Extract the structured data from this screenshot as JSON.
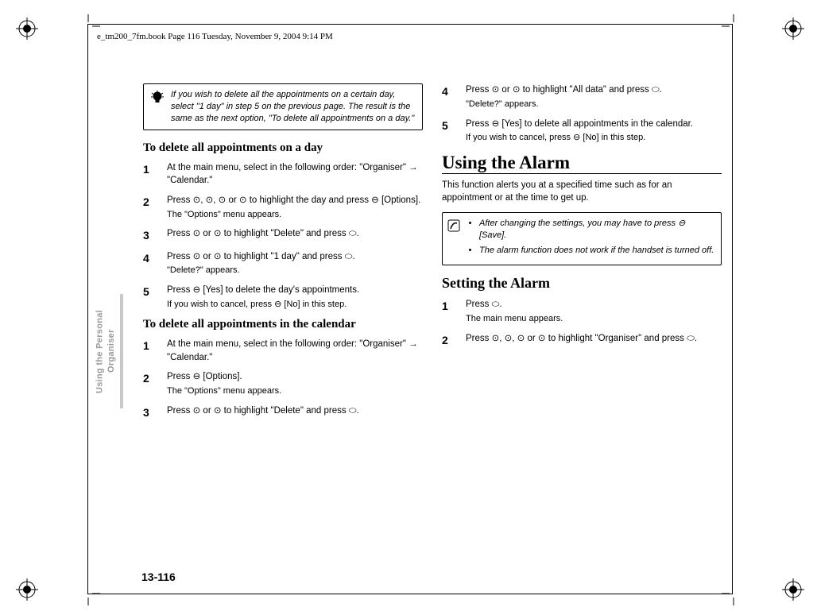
{
  "page_header": "e_tm200_7fm.book  Page 116  Tuesday, November 9, 2004  9:14 PM",
  "tip": "If you wish to delete all the appointments on a certain day, select \"1 day\" in step 5 on the previous page. The result is the same as the next option, \"To delete all appointments on a day.\"",
  "sec_a": {
    "heading": "To delete all appointments on a day",
    "steps": [
      {
        "n": "1",
        "body": "At the main menu, select in the following order: \"Organiser\" → \"Calendar.\""
      },
      {
        "n": "2",
        "body": "Press ⊙, ⊙, ⊙ or ⊙ to highlight the day and press ⊖ [Options].",
        "sub": "The \"Options\" menu appears."
      },
      {
        "n": "3",
        "body": "Press ⊙ or ⊙ to highlight \"Delete\" and press ⬭."
      },
      {
        "n": "4",
        "body": "Press ⊙ or ⊙ to highlight \"1 day\" and press ⬭.",
        "sub": "\"Delete?\" appears."
      },
      {
        "n": "5",
        "body": "Press ⊖ [Yes] to delete the day's appointments.",
        "sub": "If you wish to cancel, press ⊖ [No] in this step."
      }
    ]
  },
  "sec_b": {
    "heading": "To delete all appointments in the calendar",
    "steps": [
      {
        "n": "1",
        "body": "At the main menu, select in the following order: \"Organiser\" → \"Calendar.\""
      },
      {
        "n": "2",
        "body": "Press ⊖ [Options].",
        "sub": "The \"Options\" menu appears."
      },
      {
        "n": "3",
        "body": "Press ⊙ or ⊙ to highlight \"Delete\" and press ⬭."
      }
    ]
  },
  "sec_b2": {
    "steps": [
      {
        "n": "4",
        "body": "Press ⊙ or ⊙ to highlight \"All data\" and press ⬭.",
        "sub": "\"Delete?\" appears."
      },
      {
        "n": "5",
        "body": "Press ⊖ [Yes] to delete all appointments in the calendar.",
        "sub": "If you wish to cancel, press ⊖ [No] in this step."
      }
    ]
  },
  "sec_c": {
    "heading": "Using the Alarm",
    "intro": "This function alerts you at a specified time such as for an appointment or at the time to get up.",
    "notes": [
      "After changing the settings, you may have to press ⊖ [Save].",
      "The alarm function does not work if the handset is turned off."
    ]
  },
  "sec_d": {
    "heading": "Setting the Alarm",
    "steps": [
      {
        "n": "1",
        "body": "Press ⬭.",
        "sub": "The main menu appears."
      },
      {
        "n": "2",
        "body": "Press ⊙, ⊙, ⊙ or ⊙ to highlight \"Organiser\" and press ⬭."
      }
    ]
  },
  "sidetab": "Using the Personal Organiser",
  "page_num": "13-116"
}
